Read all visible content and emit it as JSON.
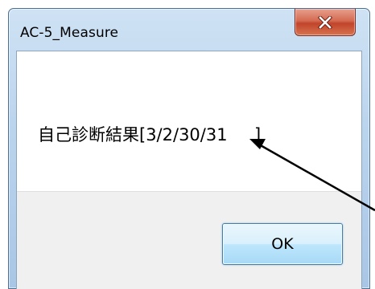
{
  "window": {
    "title": "AC-5_Measure",
    "close_icon": "close-icon"
  },
  "dialog": {
    "message": "自己診断結果[3/2/30/31     ]",
    "ok_label": "OK"
  },
  "colors": {
    "frame": "#bcd5ee",
    "close_button": "#c1452b",
    "button_area": "#f0f0f0",
    "ok_border": "#3c7fb1"
  }
}
